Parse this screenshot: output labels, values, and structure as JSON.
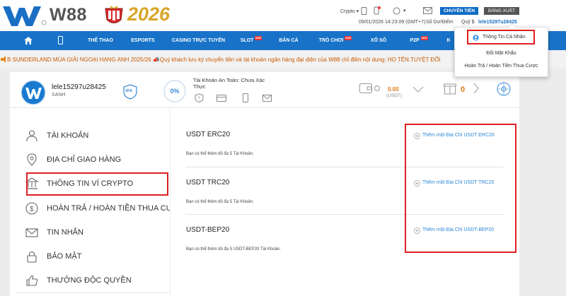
{
  "brand": {
    "name": "W88",
    "year": "2026"
  },
  "topbar": {
    "currency": "Crypto",
    "datetime": "09/01/2026 14:23:09 (GMT+7)",
    "balance_label": "Số Dư/Điểm",
    "fund_label": "Quỹ $",
    "username": "lele15297u28425",
    "transfer_button": "CHUYỂN TIỀN",
    "logout_button": "ĐĂNG XUẤT"
  },
  "nav": {
    "items": [
      {
        "label": "THỂ THAO",
        "hot": false
      },
      {
        "label": "ESPORTS",
        "hot": false
      },
      {
        "label": "CASINO TRỰC TUYẾN",
        "hot": false
      },
      {
        "label": "SLOT",
        "hot": true
      },
      {
        "label": "BẮN CÁ",
        "hot": false
      },
      {
        "label": "TRÒ CHƠI",
        "hot": true
      },
      {
        "label": "XỔ SỐ",
        "hot": false
      },
      {
        "label": "P2P",
        "hot": true
      },
      {
        "label": "K",
        "hot": false
      }
    ],
    "hot_badge": "MỚI"
  },
  "marquee": {
    "text": "B SUNDERLAND MÙA GIẢI NGOẠI HẠNG ANH 2025/26 📣Quý khách lưu ký chuyển tiền và tài khoản ngân hàng đại diện của W88 chỉ điền nội dung: HỌ TÊN.TUYỆT ĐỐI"
  },
  "user": {
    "username": "lele15297u28425",
    "tier": "XANH",
    "twofa": "2FA",
    "progress": "0%",
    "progress_value": 0,
    "security_title": "Tài Khoản An Toàn: Chưa Xác Thực",
    "balance": "0.00",
    "balance_unit": "(USDT)",
    "gift_count": "0"
  },
  "sidebar": {
    "items": [
      {
        "label": "TÀI KHOẢN",
        "icon": "user-icon"
      },
      {
        "label": "ĐỊA CHỈ GIAO HÀNG",
        "icon": "location-pin-icon"
      },
      {
        "label": "THÔNG TIN VÍ CRYPTO",
        "icon": "bank-icon"
      },
      {
        "label": "HOÀN TRẢ / HOÀN TIỀN THUA CƯỢC",
        "icon": "dollar-coin-icon"
      },
      {
        "label": "TIN NHẮN",
        "icon": "envelope-icon"
      },
      {
        "label": "BẢO MẬT",
        "icon": "lock-icon"
      },
      {
        "label": "THƯỞNG ĐỘC QUYỀN",
        "icon": "thumbs-up-icon"
      }
    ]
  },
  "wallets": [
    {
      "title": "USDT ERC20",
      "note": "Bạn có thể thêm tối đa 5 Tài Khoản.",
      "add": "Thêm một Địa Chỉ USDT ERC20"
    },
    {
      "title": "USDT TRC20",
      "note": "Bạn có thể thêm tối đa 5 Tài Khoản.",
      "add": "Thêm một Địa Chỉ USDT TRC20"
    },
    {
      "title": "USDT-BEP20",
      "note": "Bạn có thể thêm tối đa 5 USDT-BEP20 Tài Khoản.",
      "add": "Thêm một Địa Chỉ USDT-BEP20"
    }
  ],
  "dropdown": {
    "items": [
      "Thông Tin Cá Nhân",
      "Đổi Mật Khẩu",
      "Hoàn Trả / Hoàn Tiền Thua Cược"
    ]
  },
  "colors": {
    "nav": "#1873c8",
    "accent": "#2a86d6",
    "highlight": "#e02020",
    "gold": "#d9a62a"
  }
}
